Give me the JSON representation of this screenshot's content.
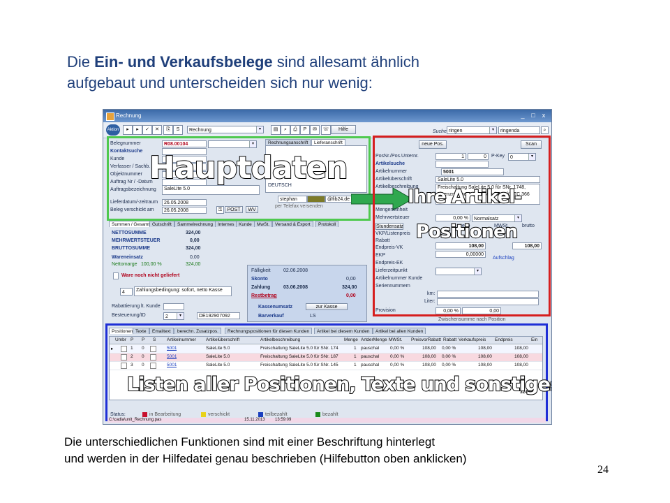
{
  "heading": {
    "prefix": "Die ",
    "bold": "Ein- und Verkaufsbelege",
    "suffix": " sind allesamt ähnlich",
    "line2": "aufgebaut und unterscheiden sich nur wenig:"
  },
  "caption": {
    "line1": "Die unterschiedlichen Funktionen sind mit einer Beschriftung hinterlegt",
    "line2": "und werden in der Hilfedatei genau beschrieben (Hilfebutton oben anklicken)"
  },
  "page_number": "24",
  "window": {
    "title": "Rechnung",
    "controls": [
      "_",
      "□",
      "x"
    ],
    "toolbar": {
      "action_label": "Aktion",
      "doc_type": "Rechnung",
      "help_label": "Hilfe"
    },
    "search": {
      "label": "Suche",
      "field1": "ringen",
      "field2": "ringenda"
    },
    "header": {
      "labels": [
        "Belegnummer",
        "Kontaktsuche",
        "Kunde",
        "Verfasser / Sachb.",
        "Objektnummer",
        "Auftrag Nr / -Datum",
        "Auftragsbezeichnung",
        "Lieferdatum/-zeitraum",
        "Beleg verschickt am"
      ],
      "belegnummer": "R08.00104",
      "auftragsbezeichnung": "SaleLite 5.0",
      "lieferdatum": "26.05.2008",
      "beleg_verschickt": "26.05.2008",
      "post_btn": "POST",
      "wv_btn": "WV",
      "address_tabs": [
        "Rechnungsanschrift",
        "Lieferanschrift"
      ],
      "country": "DEUTSCH",
      "email": "@fib24.de",
      "email_user": "stephan",
      "fax_label": "per Telefax versenden"
    },
    "sum_tabs": [
      "Summen / Gesamt",
      "Gutschrift",
      "Sammelrechnung",
      "Internes",
      "Kunde",
      "MwSt.",
      "Versand & Export",
      "Protokoll"
    ],
    "sums": {
      "netto_label": "NETTOSUMME",
      "netto": "324,00",
      "mwst_label": "MEHRWERTSTEUER",
      "mwst": "0,00",
      "brutto_label": "BRUTTOSUMME",
      "brutto": "324,00",
      "wareneinsatz_label": "Wareneinsatz",
      "wareneinsatz": "0,00",
      "nettomarge_label": "Nettomarge",
      "nettomarge_pct": "100,00 %",
      "nettomarge": "324,00",
      "ware_label": "Ware noch nicht geliefert",
      "zahlung_code": "4",
      "zahlung_text": "Zahlungsbedingung: sofort, netto Kasse",
      "rabattierung_label": "Rabattierung lt. Kunde",
      "besteuerung_label": "Besteuerung/ID",
      "besteuerung_value": "2",
      "ust_id": "DE192907092"
    },
    "payment": {
      "faelligkeit_label": "Fälligkeit",
      "faelligkeit": "02.06.2008",
      "skonto_label": "Skonto",
      "skonto": "0,00",
      "zahlung_label": "Zahlung",
      "zahlung_date": "03.06.2008",
      "zahlung": "324,00",
      "rest_label": "Restbetrag",
      "rest": "0,00",
      "kasse_label": "Kassenumsatz",
      "kasse_btn": "zur Kasse",
      "bar_label": "Barverkauf",
      "ls_label": "LS"
    },
    "position": {
      "new_btn": "neue Pos.",
      "scan_btn": "Scan",
      "labels": [
        "PosNr./Pos.Unternr.",
        "Artikelsuche",
        "Artikelnummer",
        "Artikelüberschrift",
        "Artikelbeschreibung",
        "Mengeneinheit",
        "Mehrwertsteuer",
        "Stundensatz",
        "VKP/Listenpreis",
        "Rabatt",
        "Endpreis-VK",
        "EKP",
        "Endpreis-EK",
        "Lieferzeitpunkt",
        "Artikelnummer Kunde",
        "Seriennummern",
        "Provision"
      ],
      "posnr": "1",
      "unternr": "0",
      "pkey_label": "P-Key",
      "pkey": "0",
      "artikelnummer": "5001",
      "ueberschrift": "SaleLite 5.0",
      "beschreibung1": "Freischaltung SaleLite 5.0 für SNr. 1748,",
      "beschreibung2": "Lizenznehmer: Björn Sternberg für TC 366",
      "mwst": "0,00 %",
      "mwst_type": "Normalsatz",
      "netto_hdr": "netto",
      "mwst_hdr": "MWSt.",
      "brutto_hdr": "brutto",
      "vk1": "108,00",
      "vk2": "108,00",
      "ekp": "0,00000",
      "aufschlag_label": "Aufschlag",
      "km_label": "km:",
      "liter_label": "Liter:",
      "provision_pct": "0,00 %",
      "provision": "0,00",
      "zwischensumme": "Zwischensumme nach Position"
    },
    "list_tabs": [
      "Positionen",
      "Texte",
      "Emailtext",
      "berechn. Zusatzpos.",
      "Rechnungspositionen für diesen Kunden",
      "Artikel bei diesem Kunden",
      "Artikel bei allen Kunden"
    ],
    "grid": {
      "columns": [
        "Umbr",
        "P",
        "P",
        "S",
        "Artikelnummer",
        "Artikelüberschrift",
        "Artikelbeschreibung",
        "Menge",
        "ArtderMenge",
        "MWSt.",
        "PreisvorRabatt",
        "Rabatt",
        "Verkaufspreis",
        "Endpreis",
        "Ein"
      ],
      "rows": [
        [
          "",
          "1",
          "0",
          "",
          "5001",
          "SaleLite 5.0",
          "Freischaltung SaleLite 5.0 für SNr. 174",
          "1",
          "pauschal",
          "0,00 %",
          "108,00",
          "0,00 %",
          "108,00",
          "108,00"
        ],
        [
          "",
          "2",
          "0",
          "",
          "5001",
          "SaleLite 5.0",
          "Freischaltung SaleLite 5.0 für SNr. 187",
          "1",
          "pauschal",
          "0,00 %",
          "108,00",
          "0,00 %",
          "108,00",
          "108,00"
        ],
        [
          "",
          "3",
          "0",
          "",
          "5001",
          "SaleLite 5.0",
          "Freischaltung SaleLite 5.0 für SNr. 145",
          "1",
          "pauschal",
          "0,00 %",
          "108,00",
          "0,00 %",
          "108,00",
          "108,00"
        ]
      ],
      "total": "324,00"
    },
    "status": {
      "label": "Status:",
      "items": [
        {
          "label": "in Bearbeitung",
          "color": "#c8102e"
        },
        {
          "label": "verschickt",
          "color": "#e8d21a"
        },
        {
          "label": "teilbezahlt",
          "color": "#1a3fbf"
        },
        {
          "label": "bezahlt",
          "color": "#1a8a1a"
        }
      ],
      "path": "C:\\cadia\\unit_Rechnung.pas",
      "date": "15.11.2013",
      "time": "13:59:09"
    }
  },
  "overlays": {
    "hauptdaten": "Hauptdaten",
    "artikel1": "Ihre Artikel-",
    "artikel2": "Positionen",
    "listen": "Listen aller Positionen, Texte und sonstiges"
  },
  "colors": {
    "hauptdaten_frame": "#4fc94f",
    "positionen_frame": "#d61e1e",
    "listen_frame": "#1f2fd6",
    "arrow": "#2fa84f"
  }
}
